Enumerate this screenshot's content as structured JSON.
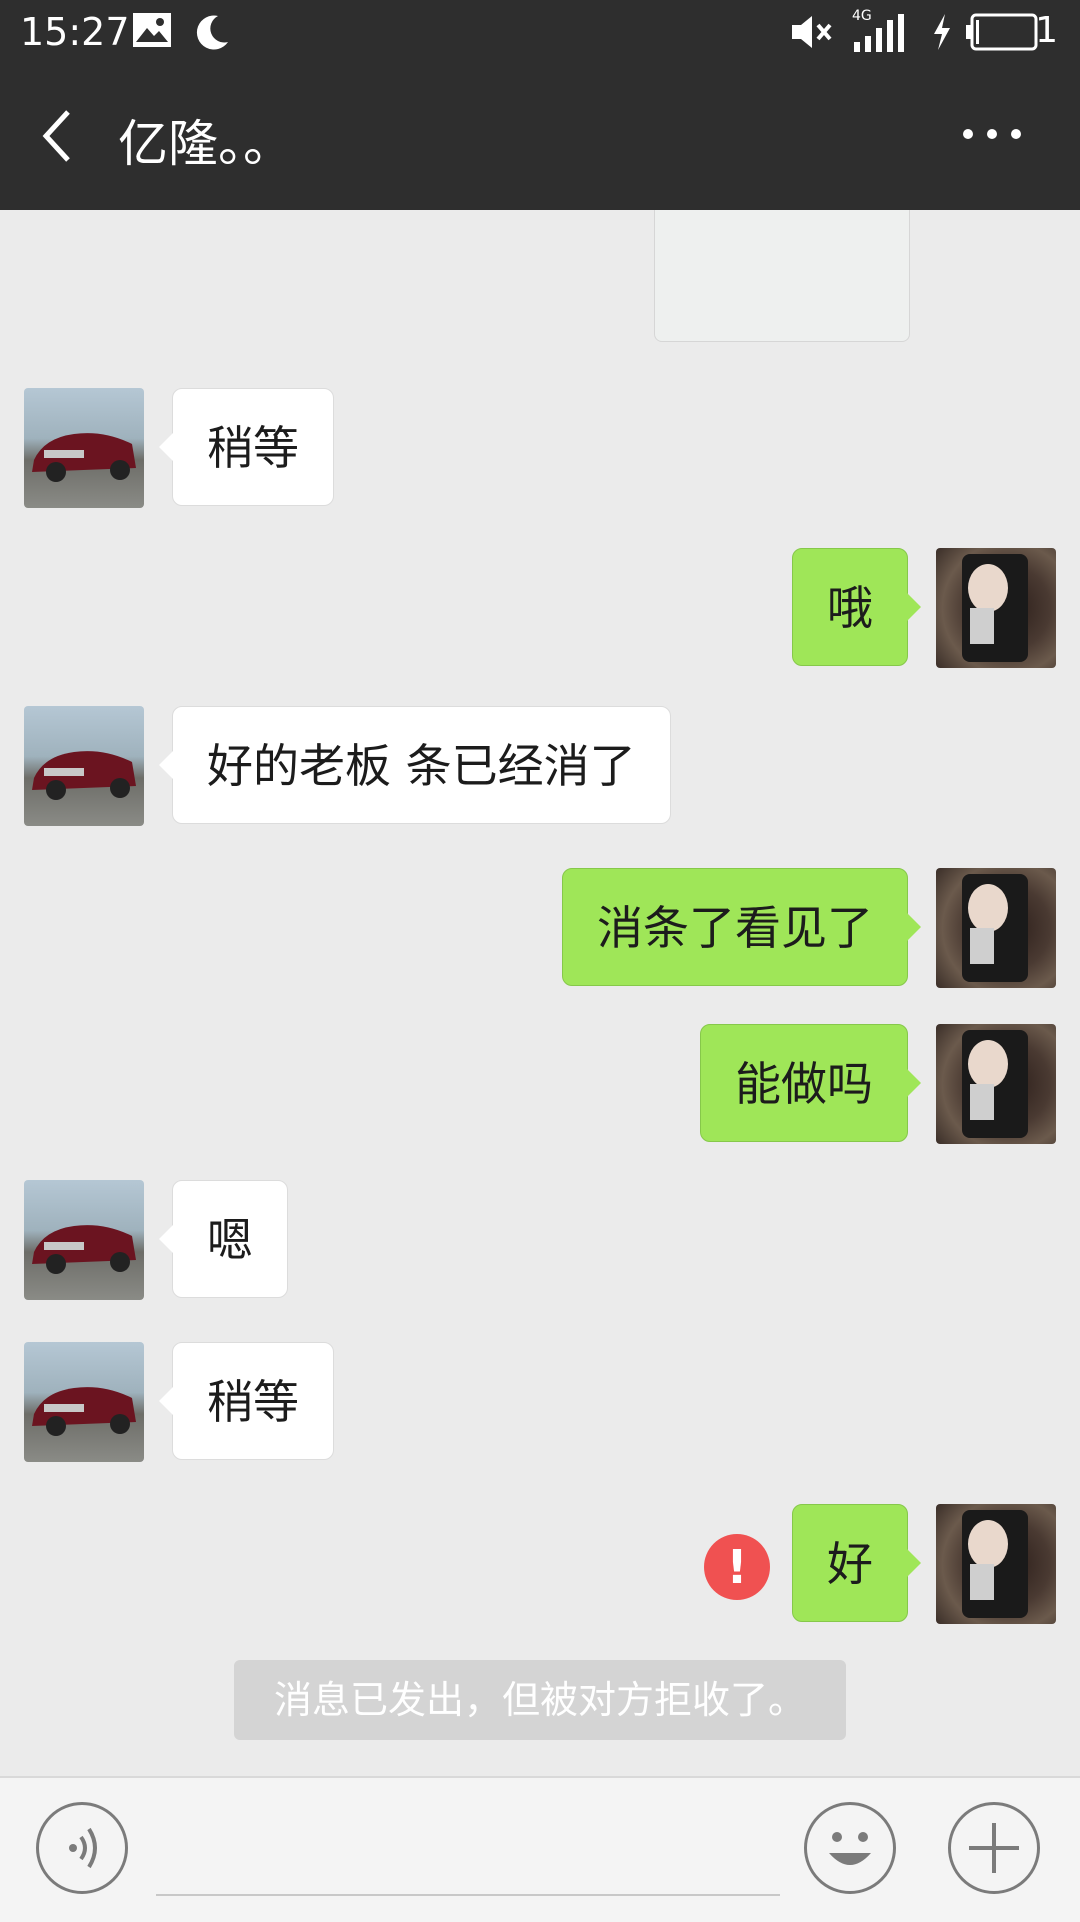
{
  "status_bar": {
    "time": "15:27",
    "network": "4G",
    "battery_level": "1",
    "icons": [
      "image-notification-icon",
      "moon-icon",
      "mute-icon",
      "signal-icon",
      "charging-icon",
      "battery-icon"
    ]
  },
  "header": {
    "title": "亿隆。。"
  },
  "messages": [
    {
      "side": "left",
      "text": "稍等"
    },
    {
      "side": "right",
      "text": "哦"
    },
    {
      "side": "left",
      "text": "好的老板 条已经消了"
    },
    {
      "side": "right",
      "text": "消条了看见了"
    },
    {
      "side": "right",
      "text": "能做吗"
    },
    {
      "side": "left",
      "text": "嗯"
    },
    {
      "side": "left",
      "text": "稍等"
    },
    {
      "side": "right",
      "text": "好",
      "failed": true,
      "error_mark": "!"
    }
  ],
  "system_notice": "消息已发出，但被对方拒收了。",
  "colors": {
    "header_bg": "#2e2e2e",
    "chat_bg": "#ebebeb",
    "sent_bubble": "#9fe658",
    "received_bubble": "#ffffff",
    "error": "#f05151"
  }
}
